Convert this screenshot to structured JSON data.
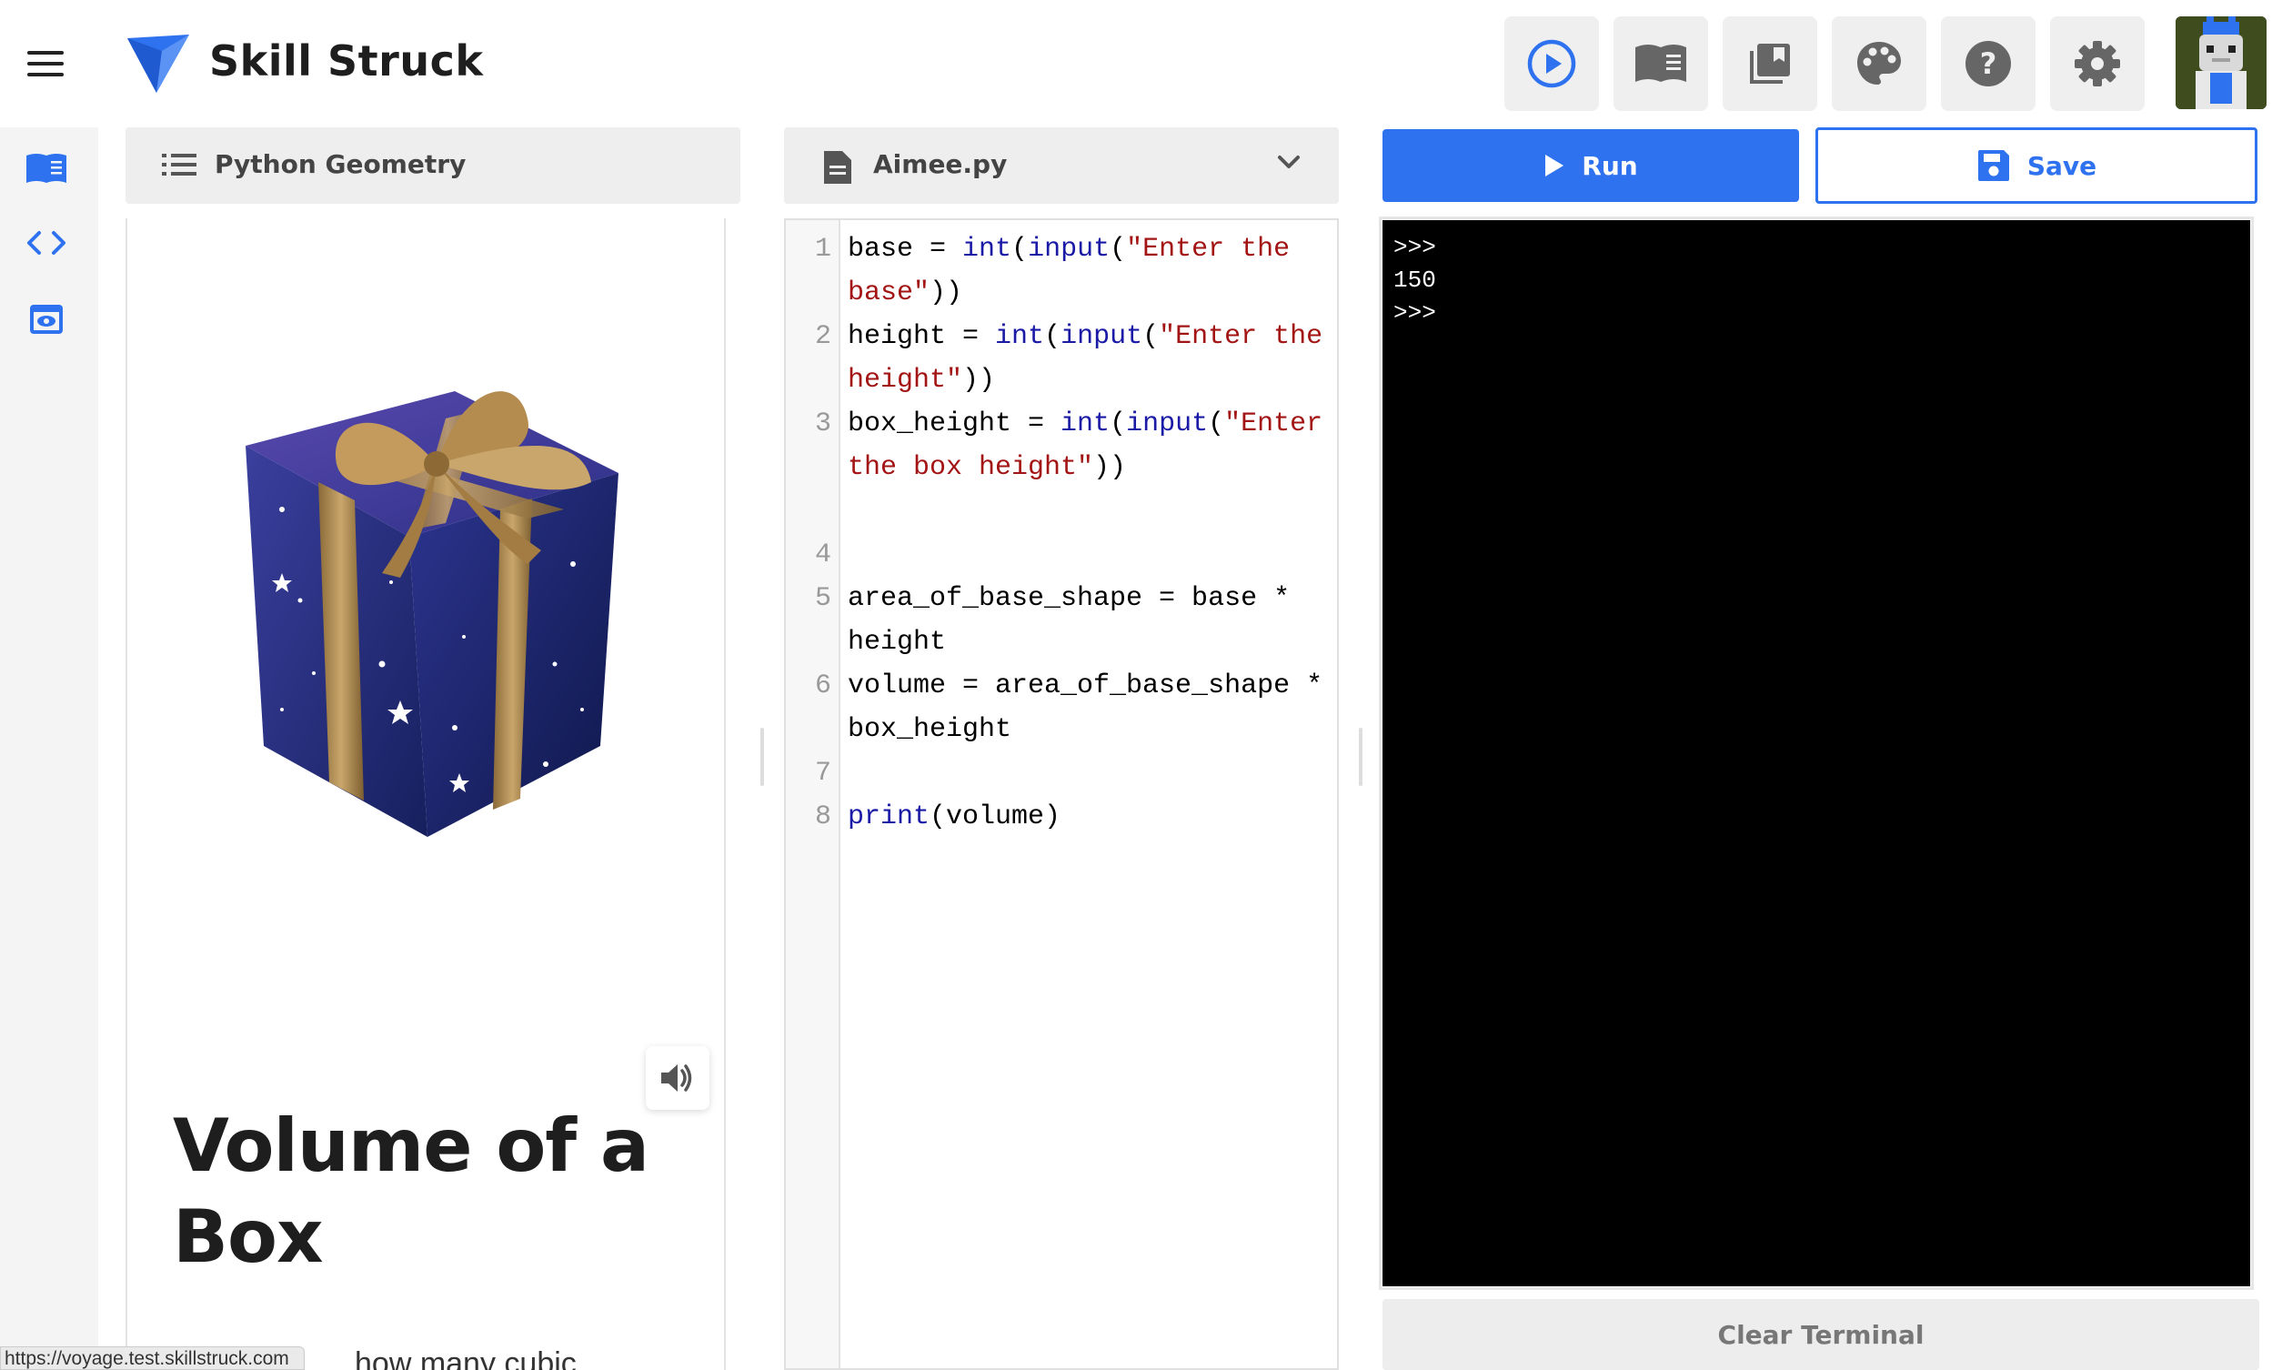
{
  "app": {
    "brand": "Skill Struck",
    "colors": {
      "accent": "#2f72f0",
      "terminal_bg": "#000000"
    }
  },
  "header": {
    "tools": [
      {
        "name": "play-circle-icon"
      },
      {
        "name": "book-open-icon"
      },
      {
        "name": "library-books-icon"
      },
      {
        "name": "palette-icon"
      },
      {
        "name": "help-icon"
      },
      {
        "name": "gear-icon"
      }
    ]
  },
  "sidebar": {
    "items": [
      {
        "name": "book-icon",
        "active": true
      },
      {
        "name": "code-icon"
      },
      {
        "name": "preview-icon"
      }
    ]
  },
  "lesson": {
    "header_title": "Python Geometry",
    "title": "Volume of a Box",
    "body_fragment": "how many cubic"
  },
  "editor": {
    "filename": "Aimee.py",
    "lines": [
      {
        "n": "1",
        "tokens": [
          [
            "",
            "base = "
          ],
          [
            "kw",
            "int"
          ],
          [
            "",
            "("
          ],
          [
            "kw",
            "input"
          ],
          [
            "",
            "("
          ],
          [
            "str",
            "\"Enter the base\""
          ],
          [
            "",
            "))"
          ]
        ]
      },
      {
        "n": "2",
        "tokens": [
          [
            "",
            "height = "
          ],
          [
            "kw",
            "int"
          ],
          [
            "",
            "("
          ],
          [
            "kw",
            "input"
          ],
          [
            "",
            "("
          ],
          [
            "str",
            "\"Enter the height\""
          ],
          [
            "",
            "))"
          ]
        ]
      },
      {
        "n": "3",
        "tokens": [
          [
            "",
            "box_height = "
          ],
          [
            "kw",
            "int"
          ],
          [
            "",
            "("
          ],
          [
            "kw",
            "input"
          ],
          [
            "",
            "("
          ],
          [
            "str",
            "\"Enter the box height\""
          ],
          [
            "",
            "))"
          ]
        ]
      },
      {
        "n": "4",
        "tokens": [
          [
            "",
            ""
          ]
        ]
      },
      {
        "n": "5",
        "tokens": [
          [
            "",
            "area_of_base_shape = base * height"
          ]
        ]
      },
      {
        "n": "6",
        "tokens": [
          [
            "",
            "volume = area_of_base_shape * box_height"
          ]
        ]
      },
      {
        "n": "7",
        "tokens": [
          [
            "",
            ""
          ]
        ]
      },
      {
        "n": "8",
        "tokens": [
          [
            "kw",
            "print"
          ],
          [
            "",
            "(volume)"
          ]
        ]
      }
    ]
  },
  "actions": {
    "run_label": "Run",
    "save_label": "Save",
    "clear_label": "Clear Terminal"
  },
  "terminal": {
    "lines": [
      ">>>",
      "150",
      ">>>"
    ]
  },
  "status_bar": {
    "url": "https://voyage.test.skillstruck.com"
  }
}
